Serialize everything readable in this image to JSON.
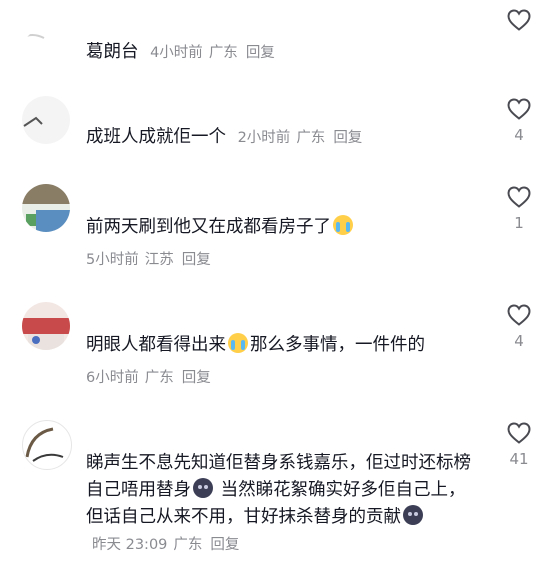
{
  "comments": [
    {
      "username": "",
      "text": "葛朗台",
      "time": "4小时前",
      "location": "广东",
      "reply": "回复",
      "likes": ""
    },
    {
      "username": "",
      "text": "成班人成就佢一个",
      "time": "2小时前",
      "location": "广东",
      "reply": "回复",
      "likes": "4"
    },
    {
      "username": "",
      "text_before_emoji": "前两天刷到他又在成都看房子了",
      "emoji": "crying-face-emoji",
      "time": "5小时前",
      "location": "江苏",
      "reply": "回复",
      "likes": "1"
    },
    {
      "username": "",
      "text_before_emoji": "明眼人都看得出来",
      "emoji": "crying-face-emoji",
      "text_after_emoji": "那么多事情，一件件的",
      "time": "6小时前",
      "location": "广东",
      "reply": "回复",
      "likes": "4"
    },
    {
      "username": "",
      "text_part1": "睇声生不息先知道佢替身系钱嘉乐，佢过时还标榜自己唔用替身",
      "emoji1": "dark-face-emoji",
      "text_part2": " 当然睇花絮确实好多佢自己上，但话自己从来不用，甘好抹杀替身的贡献",
      "emoji2": "dark-face-emoji",
      "time": "昨天 23:09",
      "location": "广东",
      "reply": "回复",
      "likes": "41"
    }
  ],
  "icons": {
    "like": "heart-outline-icon"
  },
  "colors": {
    "text": "#161823",
    "meta": "#8a8b91",
    "icon": "#4a4b52"
  }
}
